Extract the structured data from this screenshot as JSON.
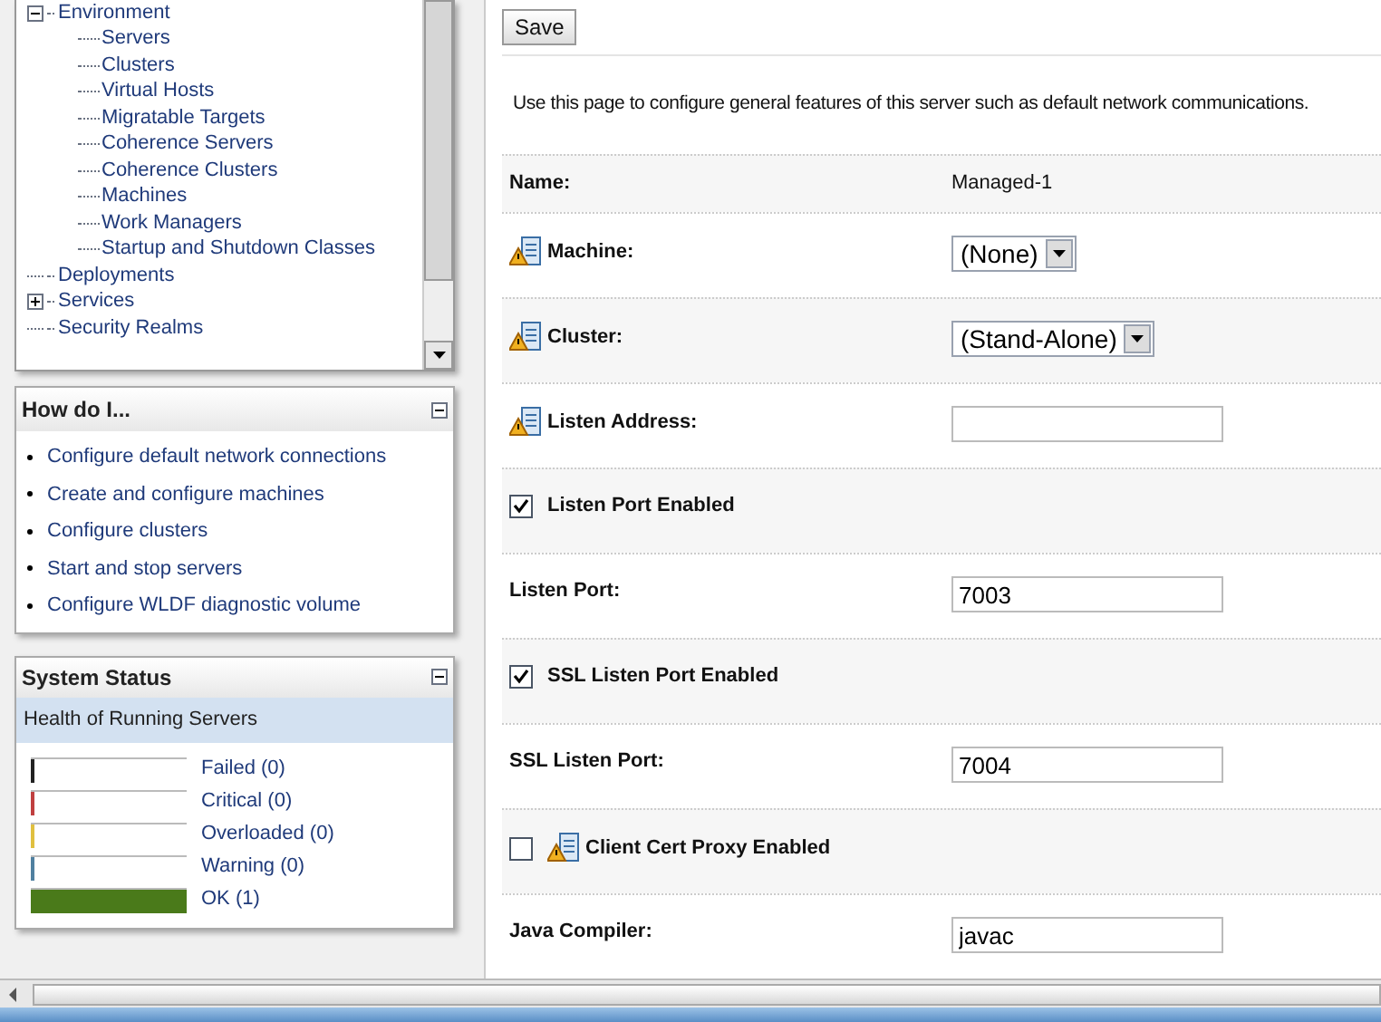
{
  "tree": [
    {
      "label": "Environment",
      "expanded": true,
      "children": [
        {
          "label": "Servers"
        },
        {
          "label": "Clusters"
        },
        {
          "label": "Virtual Hosts"
        },
        {
          "label": "Migratable Targets"
        },
        {
          "label": "Coherence Servers"
        },
        {
          "label": "Coherence Clusters"
        },
        {
          "label": "Machines"
        },
        {
          "label": "Work Managers"
        },
        {
          "label": "Startup and Shutdown Classes"
        }
      ]
    },
    {
      "label": "Deployments"
    },
    {
      "label": "Services",
      "expanded": false
    },
    {
      "label": "Security Realms"
    }
  ],
  "how_do_i": {
    "title": "How do I...",
    "links": [
      "Configure default network connections",
      "Create and configure machines",
      "Configure clusters",
      "Start and stop servers",
      "Configure WLDF diagnostic volume"
    ]
  },
  "system_status": {
    "title": "System Status",
    "subtitle": "Health of Running Servers",
    "statuses": [
      {
        "label": "Failed (0)",
        "color": "#222222",
        "level": 0
      },
      {
        "label": "Critical (0)",
        "color": "#c04040",
        "level": 0
      },
      {
        "label": "Overloaded (0)",
        "color": "#e0c040",
        "level": 0
      },
      {
        "label": "Warning (0)",
        "color": "#5080a0",
        "level": 0
      },
      {
        "label": "OK (1)",
        "color": "#4a7a1a",
        "level": 1
      }
    ]
  },
  "save_button": "Save",
  "intro": "Use this page to configure general features of this server such as default network communications.",
  "form": [
    {
      "kind": "text",
      "label": "Name:",
      "value": "Managed-1",
      "warning": false
    },
    {
      "kind": "select",
      "label": "Machine:",
      "value": "(None)",
      "warning": true
    },
    {
      "kind": "select",
      "label": "Cluster:",
      "value": "(Stand-Alone)",
      "warning": true
    },
    {
      "kind": "input",
      "label": "Listen Address:",
      "warning": true
    },
    {
      "kind": "checkbox",
      "label": "Listen Port Enabled",
      "checked": true,
      "warning": false
    },
    {
      "kind": "input",
      "label": "Listen Port:",
      "value": "7003",
      "warning": false
    },
    {
      "kind": "checkbox",
      "label": "SSL Listen Port Enabled",
      "checked": true,
      "warning": false
    },
    {
      "kind": "input",
      "label": "SSL Listen Port:",
      "value": "7004",
      "warning": false
    },
    {
      "kind": "checkbox",
      "label": "Client Cert Proxy Enabled",
      "checked": false,
      "warning": true
    },
    {
      "kind": "input",
      "label": "Java Compiler:",
      "value": "javac",
      "warning": false
    }
  ]
}
